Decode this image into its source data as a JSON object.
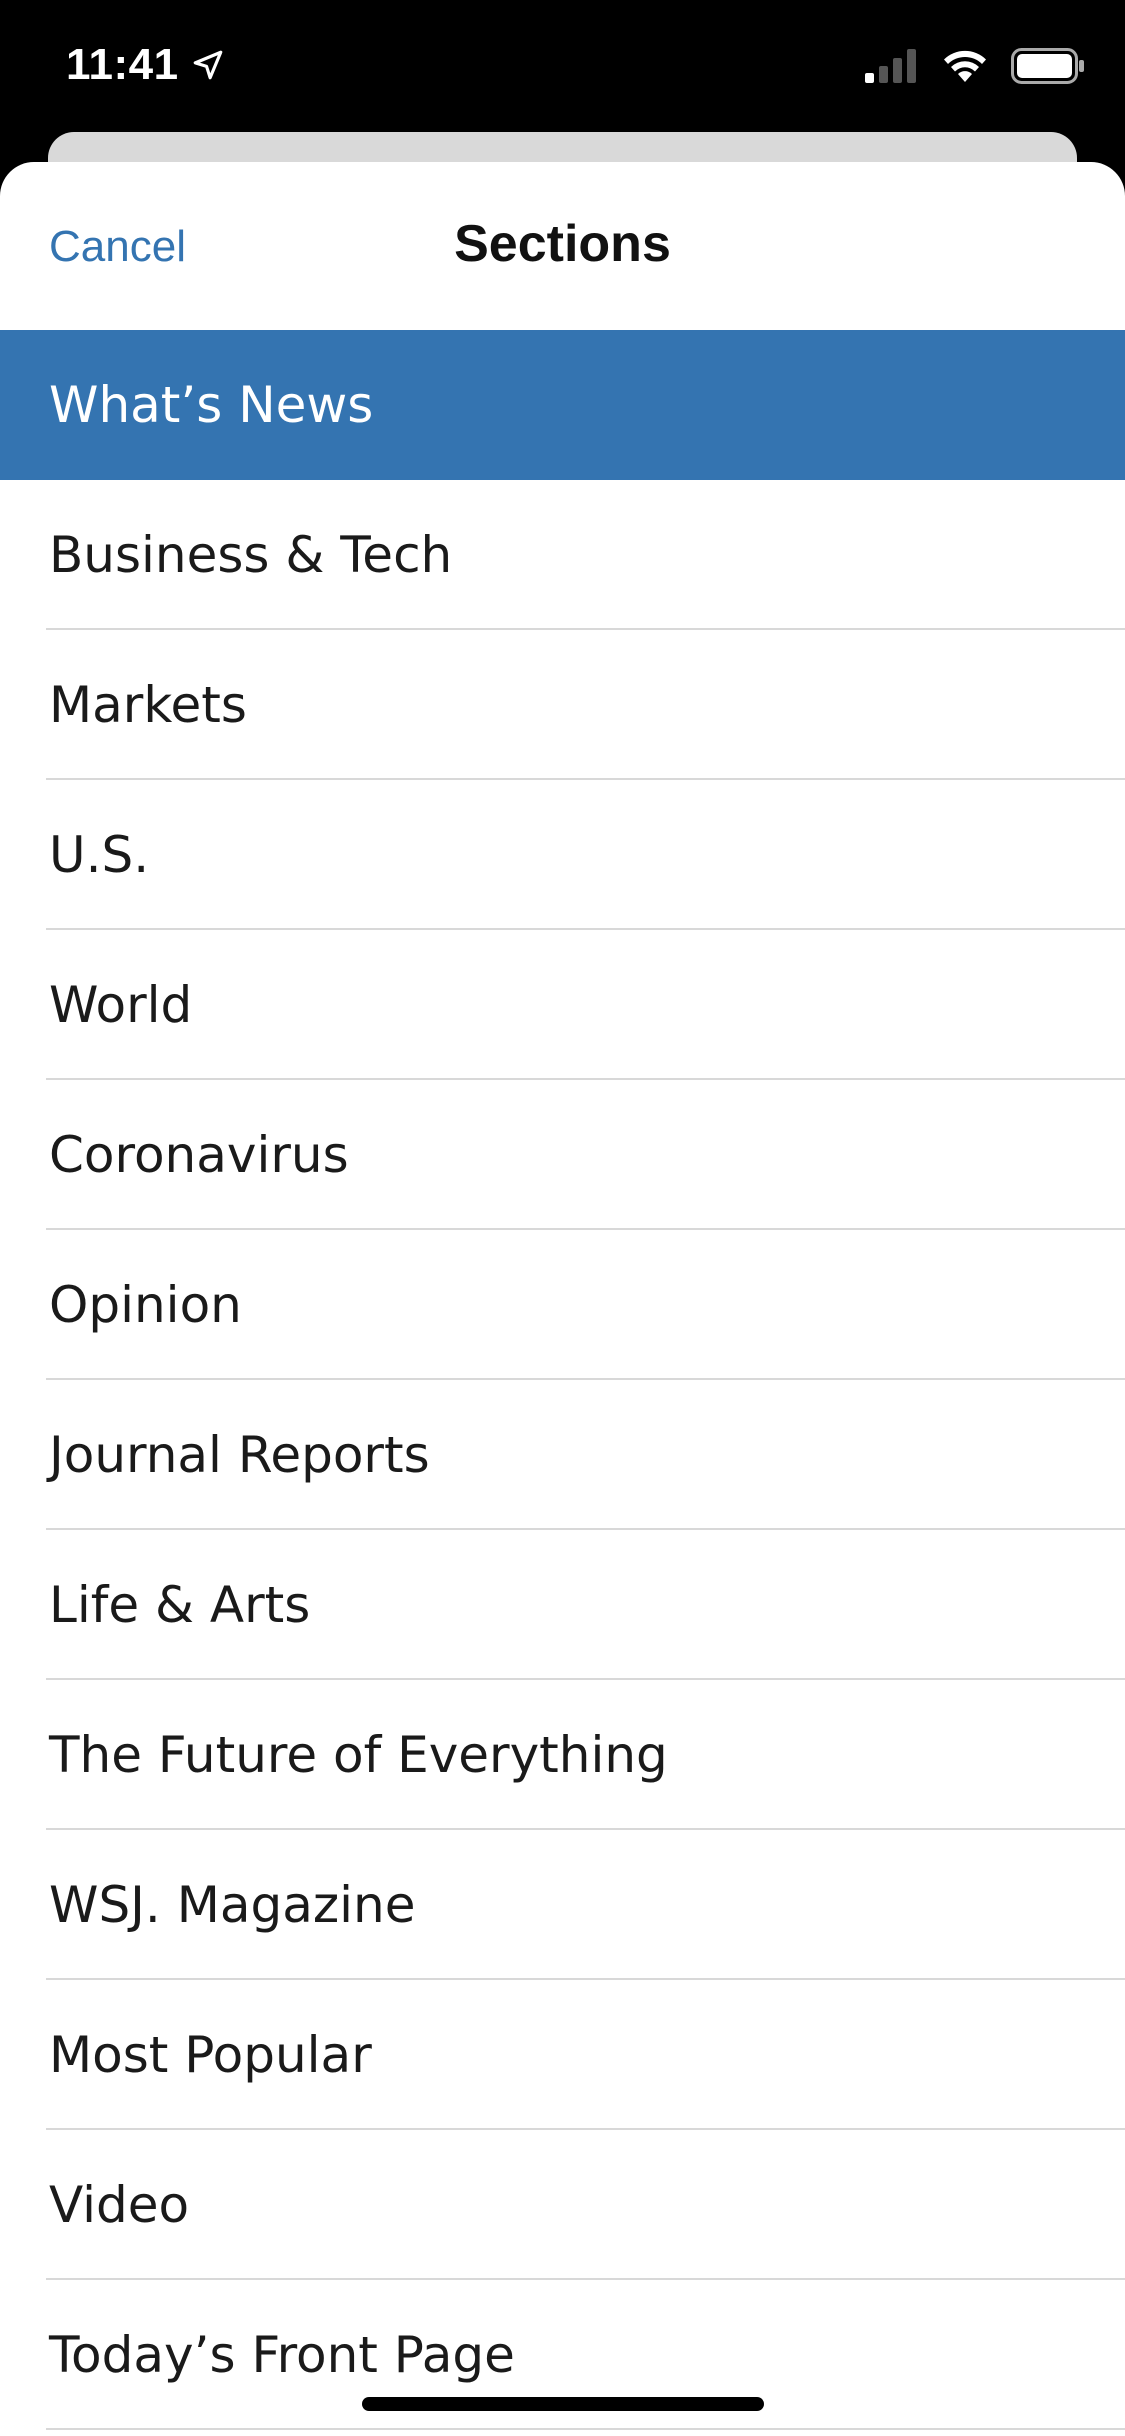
{
  "status_bar": {
    "time": "11:41",
    "location_icon": "location-arrow-icon",
    "signal_icon": "cellular-signal-icon",
    "wifi_icon": "wifi-icon",
    "battery_icon": "battery-icon"
  },
  "nav": {
    "cancel_label": "Cancel",
    "title": "Sections"
  },
  "colors": {
    "accent": "#3474b1",
    "selected_bg": "#3474b1",
    "separator": "#d8d8d8"
  },
  "sections": {
    "selected_index": 0,
    "items": [
      {
        "label": "What’s News"
      },
      {
        "label": "Business & Tech"
      },
      {
        "label": "Markets"
      },
      {
        "label": "U.S."
      },
      {
        "label": "World"
      },
      {
        "label": "Coronavirus"
      },
      {
        "label": "Opinion"
      },
      {
        "label": "Journal Reports"
      },
      {
        "label": "Life & Arts"
      },
      {
        "label": "The Future of Everything"
      },
      {
        "label": "WSJ. Magazine"
      },
      {
        "label": "Most Popular"
      },
      {
        "label": "Video"
      },
      {
        "label": "Today’s Front Page"
      }
    ]
  }
}
